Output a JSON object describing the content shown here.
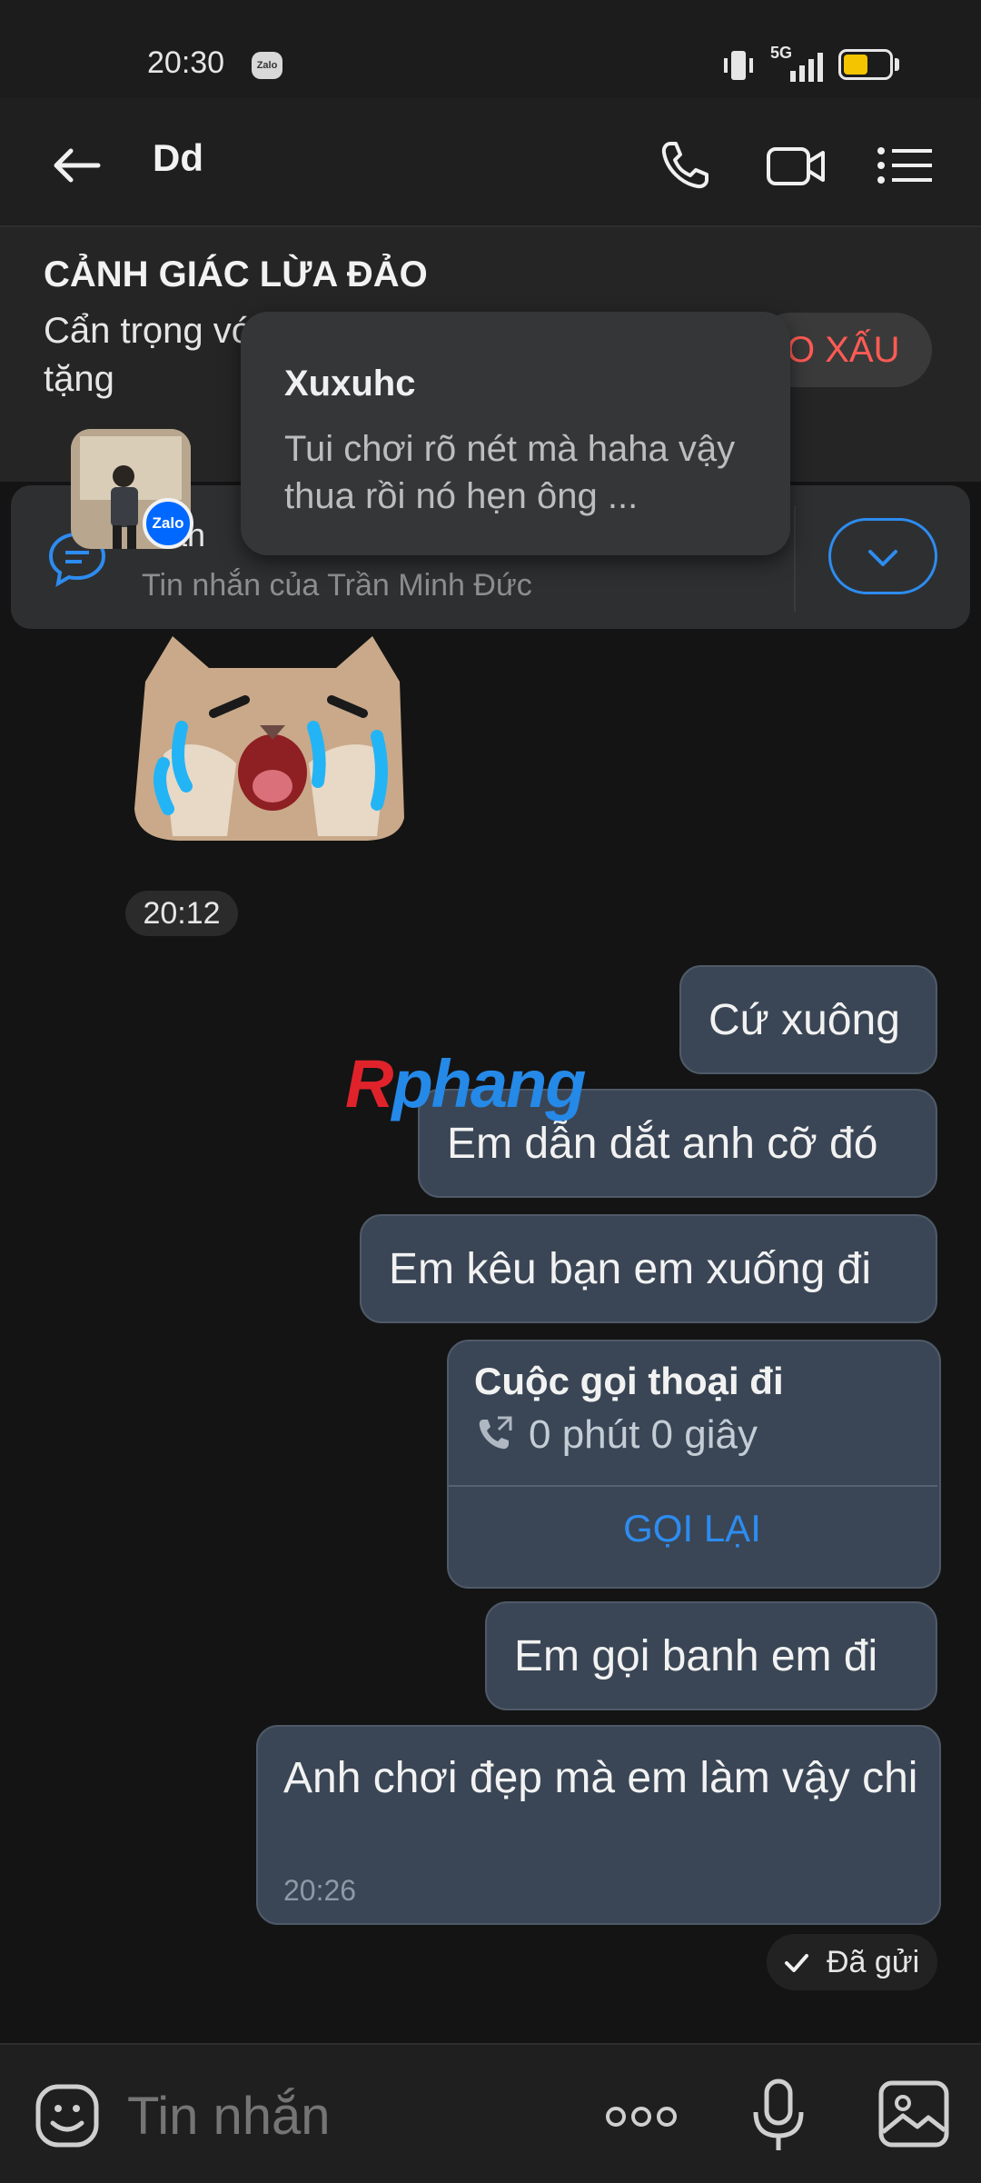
{
  "status_bar": {
    "time": "20:30",
    "app_badge": "Zalo",
    "network": "5G"
  },
  "header": {
    "contact_name": "Dd"
  },
  "warning": {
    "title": "CẢNH GIÁC LỪA ĐẢO",
    "body": "Cẩn trọng vớ giả mạo cán đặt cọc, tặng",
    "report_label": "O XẤU"
  },
  "notification": {
    "sender_partial": "h an",
    "subtitle": "Tin nhắn của Trần Minh Đức",
    "avatar_badge": "Zalo"
  },
  "popup": {
    "title": "Xuxuhc",
    "message": "Tui chơi rõ nét mà haha vậy thua rồi nó hẹn ông ..."
  },
  "chat": {
    "sticker_time": "20:12",
    "messages": [
      "Cứ xuông",
      "Em dẫn dắt anh cỡ đó",
      "Em kêu bạn em xuống đi"
    ],
    "call": {
      "title": "Cuộc gọi thoại đi",
      "duration": "0 phút 0 giây",
      "action": "GỌI LẠI"
    },
    "after_call": "Em gọi banh em đi",
    "last_message": {
      "text": "Anh chơi đẹp mà em làm vậy chi",
      "time": "20:26"
    },
    "sent_status": "Đã gửi"
  },
  "watermark": {
    "part1": "R",
    "part2": "phang"
  },
  "input": {
    "placeholder": "Tin nhắn"
  },
  "colors": {
    "accent": "#2d8cf0",
    "bubble": "#3a4655",
    "warning_red": "#ff5b54"
  }
}
